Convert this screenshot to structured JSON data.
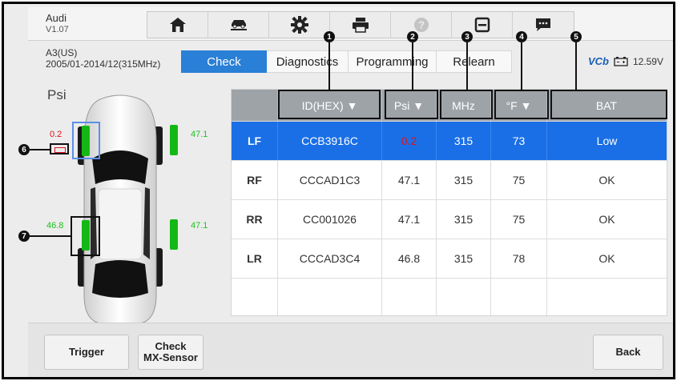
{
  "header": {
    "make": "Audi",
    "version": "V1.07",
    "toolbar": [
      {
        "icon": "home-icon"
      },
      {
        "icon": "car-lift-icon"
      },
      {
        "icon": "gear-icon"
      },
      {
        "icon": "printer-icon"
      },
      {
        "icon": "help-icon"
      },
      {
        "icon": "save-icon"
      },
      {
        "icon": "message-icon"
      }
    ]
  },
  "vehicle": {
    "model": "A3(US)",
    "range": "2005/01-2014/12(315MHz)"
  },
  "tabs": [
    "Check",
    "Diagnostics",
    "Programming",
    "Relearn"
  ],
  "active_tab": "Check",
  "status": {
    "vcb": "VCb",
    "voltage": "12.59V"
  },
  "unit_label": "Psi",
  "car": {
    "lf_pressure": "0.2",
    "rf_pressure": "47.1",
    "lr_pressure": "46.8",
    "rr_pressure": "47.1"
  },
  "callouts": [
    "1",
    "2",
    "3",
    "4",
    "5",
    "6",
    "7"
  ],
  "table": {
    "headers": [
      "",
      "ID(HEX) ▼",
      "Psi ▼",
      "MHz",
      "°F ▼",
      "BAT"
    ],
    "rows": [
      {
        "pos": "LF",
        "id": "CCB3916C",
        "psi": "0.2",
        "mhz": "315",
        "temp": "73",
        "bat": "Low"
      },
      {
        "pos": "RF",
        "id": "CCCAD1C3",
        "psi": "47.1",
        "mhz": "315",
        "temp": "75",
        "bat": "OK"
      },
      {
        "pos": "RR",
        "id": "CC001026",
        "psi": "47.1",
        "mhz": "315",
        "temp": "75",
        "bat": "OK"
      },
      {
        "pos": "LR",
        "id": "CCCAD3C4",
        "psi": "46.8",
        "mhz": "315",
        "temp": "78",
        "bat": "OK"
      }
    ]
  },
  "buttons": {
    "trigger": "Trigger",
    "check_line1": "Check",
    "check_line2": "MX-Sensor",
    "back": "Back"
  },
  "colors": {
    "accent": "#2a7fd6",
    "selected_row": "#1a6fe6",
    "low_pressure": "#e0121a",
    "ok_pressure": "#1cc31c"
  }
}
